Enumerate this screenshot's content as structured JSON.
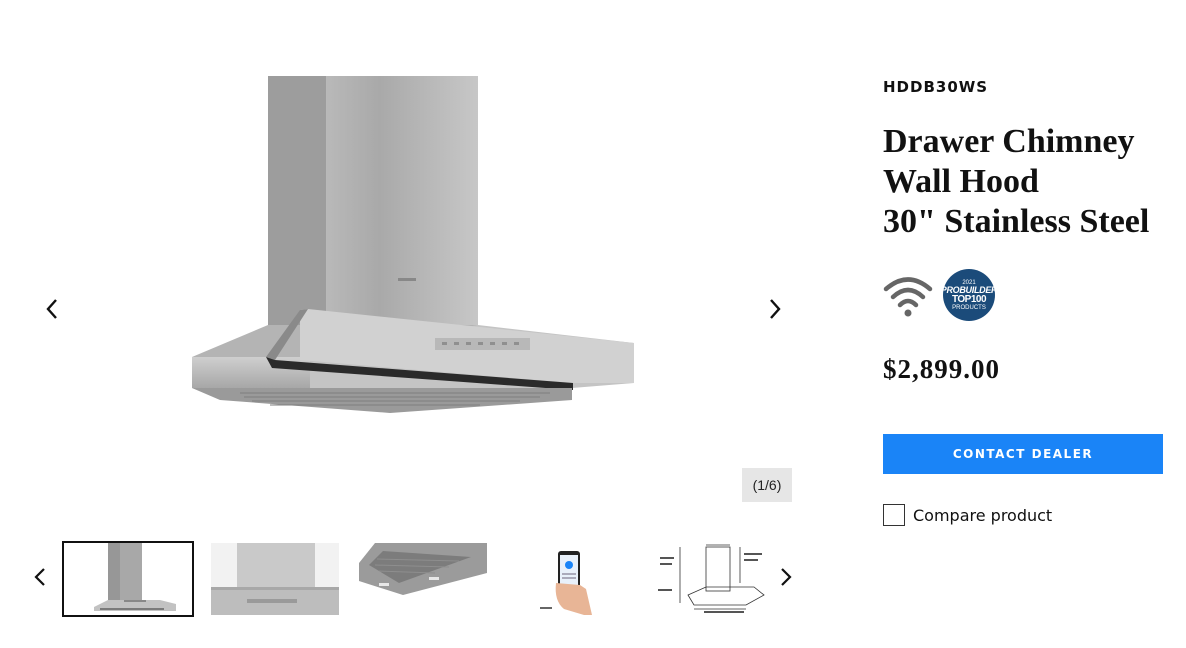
{
  "gallery": {
    "counter": "(1/6)",
    "main_image": "range-hood-main-image",
    "arrow_icon": "chevron-icon",
    "thumbnails": [
      {
        "icon": "hood-front-thumbnail",
        "active": true
      },
      {
        "icon": "hood-control-panel-thumbnail",
        "active": false
      },
      {
        "icon": "hood-underside-thumbnail",
        "active": false
      },
      {
        "icon": "smartphone-app-thumbnail",
        "active": false
      },
      {
        "icon": "dimension-drawing-thumbnail",
        "active": false
      }
    ]
  },
  "product": {
    "sku": "HDDB30WS",
    "title_lines": [
      "Drawer Chimney",
      "Wall Hood",
      "30\" Stainless Steel"
    ],
    "badges": {
      "wifi_icon": "wifi-icon",
      "award": {
        "year": "2021",
        "line1": "PROBUILDER",
        "line2": "TOP100",
        "line3": "PRODUCTS"
      }
    },
    "price": "$2,899.00",
    "contact_label": "CONTACT DEALER",
    "compare_label": "Compare product"
  },
  "colors": {
    "accent": "#1a84f7",
    "counter_bg": "#e6e6e6",
    "award_bg": "#1b4b7a",
    "text": "#111111"
  }
}
